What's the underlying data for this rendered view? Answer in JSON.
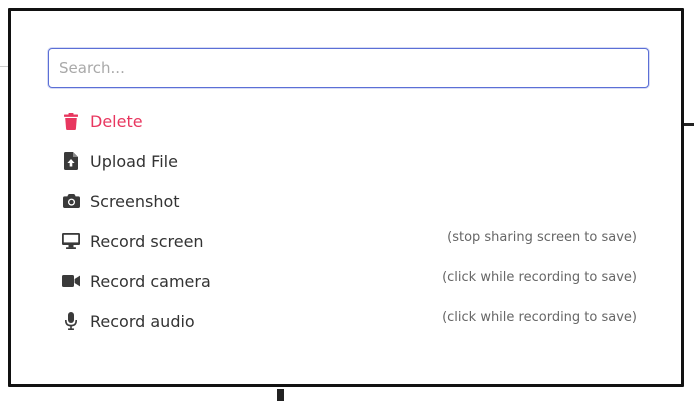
{
  "search": {
    "placeholder": "Search..."
  },
  "menu": {
    "items": [
      {
        "label": "Delete",
        "icon": "trash-icon",
        "hint": "",
        "color": "#e8375f"
      },
      {
        "label": "Upload File",
        "icon": "file-upload-icon",
        "hint": ""
      },
      {
        "label": "Screenshot",
        "icon": "camera-icon",
        "hint": ""
      },
      {
        "label": "Record screen",
        "icon": "monitor-icon",
        "hint": "(stop sharing screen to save)"
      },
      {
        "label": "Record camera",
        "icon": "video-camera-icon",
        "hint": "(click while recording to save)"
      },
      {
        "label": "Record audio",
        "icon": "microphone-icon",
        "hint": "(click while recording to save)"
      }
    ]
  }
}
